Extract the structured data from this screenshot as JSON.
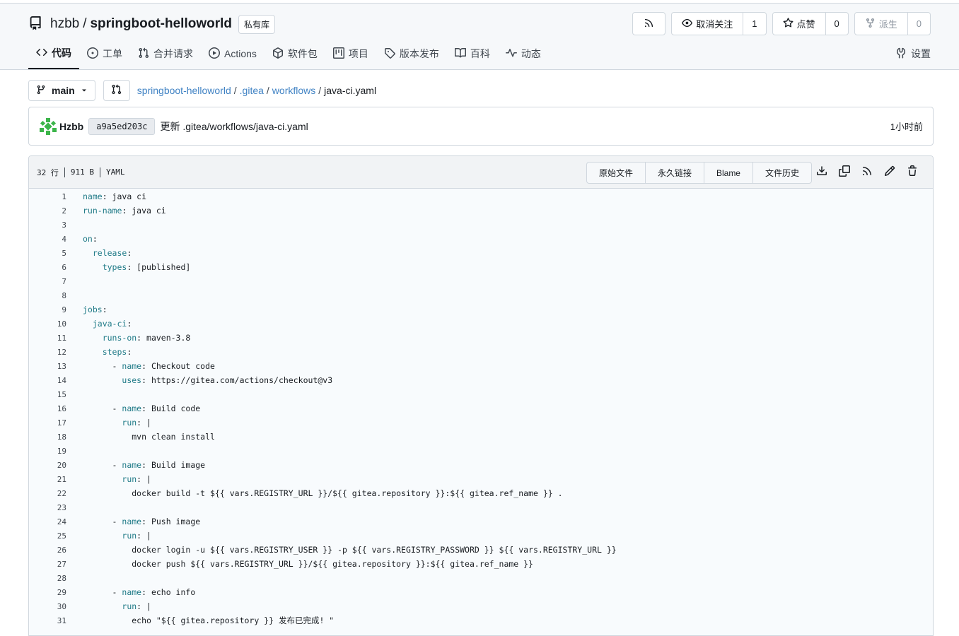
{
  "repo": {
    "owner": "hzbb",
    "name": "springboot-helloworld",
    "visibility_badge": "私有库",
    "unwatch_label": "取消关注",
    "watch_count": "1",
    "star_label": "点赞",
    "star_count": "0",
    "fork_label": "派生",
    "fork_count": "0"
  },
  "tabs": [
    {
      "label": "代码",
      "icon": "code-icon"
    },
    {
      "label": "工单",
      "icon": "issue-icon"
    },
    {
      "label": "合并请求",
      "icon": "pull-request-icon"
    },
    {
      "label": "Actions",
      "icon": "play-icon"
    },
    {
      "label": "软件包",
      "icon": "package-icon"
    },
    {
      "label": "项目",
      "icon": "project-icon"
    },
    {
      "label": "版本发布",
      "icon": "tag-icon"
    },
    {
      "label": "百科",
      "icon": "book-icon"
    },
    {
      "label": "动态",
      "icon": "pulse-icon"
    }
  ],
  "settings_label": "设置",
  "branch": "main",
  "breadcrumb": {
    "repo": "springboot-helloworld",
    "dir1": ".gitea",
    "dir2": "workflows",
    "file": "java-ci.yaml",
    "sep": "/"
  },
  "commit": {
    "author": "Hzbb",
    "sha": "a9a5ed203c",
    "message": "更新 .gitea/workflows/java-ci.yaml",
    "time": "1小时前"
  },
  "file": {
    "lines_info": "32 行",
    "size_info": "911 B",
    "lang_info": "YAML",
    "buttons": {
      "raw": "原始文件",
      "permalink": "永久链接",
      "blame": "Blame",
      "history": "文件历史"
    }
  },
  "code_lines": [
    {
      "n": "1",
      "indent": "",
      "key": "name",
      "rest": ": java ci"
    },
    {
      "n": "2",
      "indent": "",
      "key": "run-name",
      "rest": ": java ci"
    },
    {
      "n": "3",
      "indent": "",
      "key": "",
      "rest": ""
    },
    {
      "n": "4",
      "indent": "",
      "key": "on",
      "rest": ":"
    },
    {
      "n": "5",
      "indent": "  ",
      "key": "release",
      "rest": ":"
    },
    {
      "n": "6",
      "indent": "    ",
      "key": "types",
      "rest": ": [published]"
    },
    {
      "n": "7",
      "indent": "",
      "key": "",
      "rest": ""
    },
    {
      "n": "8",
      "indent": "",
      "key": "",
      "rest": ""
    },
    {
      "n": "9",
      "indent": "",
      "key": "jobs",
      "rest": ":"
    },
    {
      "n": "10",
      "indent": "  ",
      "key": "java-ci",
      "rest": ":"
    },
    {
      "n": "11",
      "indent": "    ",
      "key": "runs-on",
      "rest": ": maven-3.8"
    },
    {
      "n": "12",
      "indent": "    ",
      "key": "steps",
      "rest": ":"
    },
    {
      "n": "13",
      "indent": "      - ",
      "key": "name",
      "rest": ": Checkout code"
    },
    {
      "n": "14",
      "indent": "        ",
      "key": "uses",
      "rest": ": https://gitea.com/actions/checkout@v3"
    },
    {
      "n": "15",
      "indent": "",
      "key": "",
      "rest": ""
    },
    {
      "n": "16",
      "indent": "      - ",
      "key": "name",
      "rest": ": Build code"
    },
    {
      "n": "17",
      "indent": "        ",
      "key": "run",
      "rest": ": |"
    },
    {
      "n": "18",
      "indent": "          ",
      "key": "",
      "rest": "mvn clean install"
    },
    {
      "n": "19",
      "indent": "",
      "key": "",
      "rest": ""
    },
    {
      "n": "20",
      "indent": "      - ",
      "key": "name",
      "rest": ": Build image"
    },
    {
      "n": "21",
      "indent": "        ",
      "key": "run",
      "rest": ": |"
    },
    {
      "n": "22",
      "indent": "          ",
      "key": "",
      "rest": "docker build -t ${{ vars.REGISTRY_URL }}/${{ gitea.repository }}:${{ gitea.ref_name }} ."
    },
    {
      "n": "23",
      "indent": "",
      "key": "",
      "rest": ""
    },
    {
      "n": "24",
      "indent": "      - ",
      "key": "name",
      "rest": ": Push image"
    },
    {
      "n": "25",
      "indent": "        ",
      "key": "run",
      "rest": ": |"
    },
    {
      "n": "26",
      "indent": "          ",
      "key": "",
      "rest": "docker login -u ${{ vars.REGISTRY_USER }} -p ${{ vars.REGISTRY_PASSWORD }} ${{ vars.REGISTRY_URL }}"
    },
    {
      "n": "27",
      "indent": "          ",
      "key": "",
      "rest": "docker push ${{ vars.REGISTRY_URL }}/${{ gitea.repository }}:${{ gitea.ref_name }}"
    },
    {
      "n": "28",
      "indent": "",
      "key": "",
      "rest": ""
    },
    {
      "n": "29",
      "indent": "      - ",
      "key": "name",
      "rest": ": echo info"
    },
    {
      "n": "30",
      "indent": "        ",
      "key": "run",
      "rest": ": |"
    },
    {
      "n": "31",
      "indent": "          ",
      "key": "",
      "rest": "echo \"${{ gitea.repository }} 发布已完成! \""
    }
  ]
}
